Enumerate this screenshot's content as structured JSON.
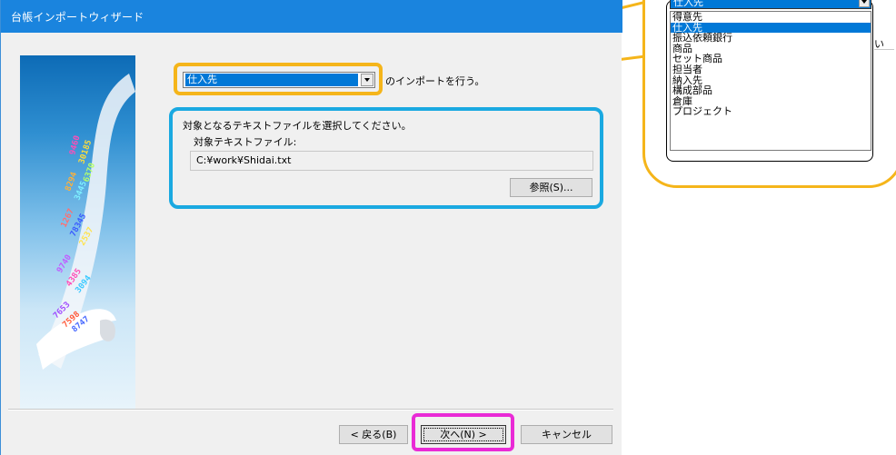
{
  "window": {
    "title": "台帳インポートウィザード"
  },
  "import": {
    "selected": "仕入先",
    "suffix": "のインポートを行う。"
  },
  "file": {
    "instruction": "対象となるテキストファイルを選択してください。",
    "label": "対象テキストファイル:",
    "path": "C:¥work¥Shidai.txt",
    "browse_label": "参照(S)..."
  },
  "buttons": {
    "back_label": "< 戻る(B)",
    "next_label": "次へ(N) >",
    "cancel_label": "キャンセル"
  },
  "dropdown": {
    "top_value": "仕入先",
    "items": [
      {
        "label": "得意先",
        "selected": false
      },
      {
        "label": "仕入先",
        "selected": true
      },
      {
        "label": "振込依頼銀行",
        "selected": false
      },
      {
        "label": "商品",
        "selected": false
      },
      {
        "label": "セット商品",
        "selected": false
      },
      {
        "label": "担当者",
        "selected": false
      },
      {
        "label": "納入先",
        "selected": false
      },
      {
        "label": "構成部品",
        "selected": false
      },
      {
        "label": "倉庫",
        "selected": false
      },
      {
        "label": "プロジェクト",
        "selected": false
      }
    ],
    "tail_text": "い"
  },
  "colors": {
    "title_bar": "#1a84de",
    "highlight_orange": "#f5b51a",
    "highlight_blue": "#1aa9e1",
    "highlight_magenta": "#e92ad6",
    "selection": "#0078d7"
  }
}
